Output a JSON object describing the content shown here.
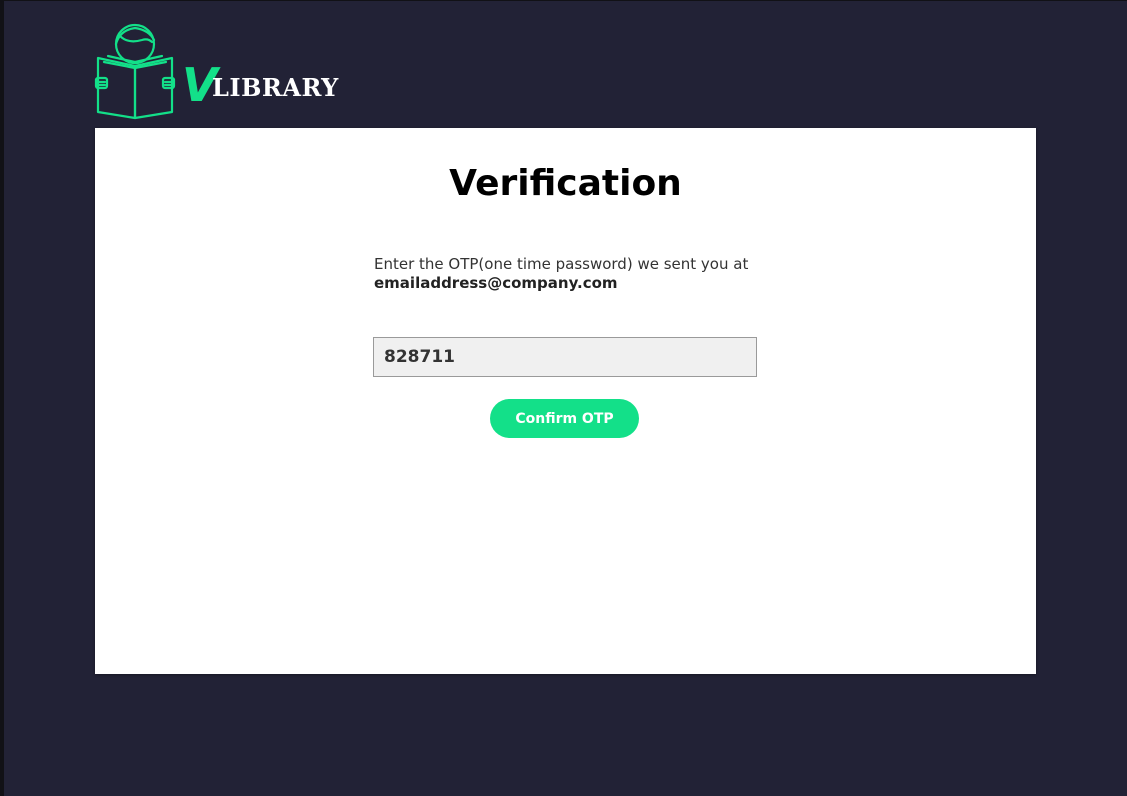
{
  "brand": {
    "logo_v": "V",
    "logo_word": "LIBRARY",
    "logo_icon": "reading-book-icon",
    "accent_color": "#13e089"
  },
  "page": {
    "background_color": "#222236"
  },
  "verification": {
    "title": "Verification",
    "instruction_text": "Enter the OTP(one time password) we sent you at ",
    "email": "emailaddress@company.com",
    "otp_value": "828711",
    "confirm_label": "Confirm OTP"
  }
}
